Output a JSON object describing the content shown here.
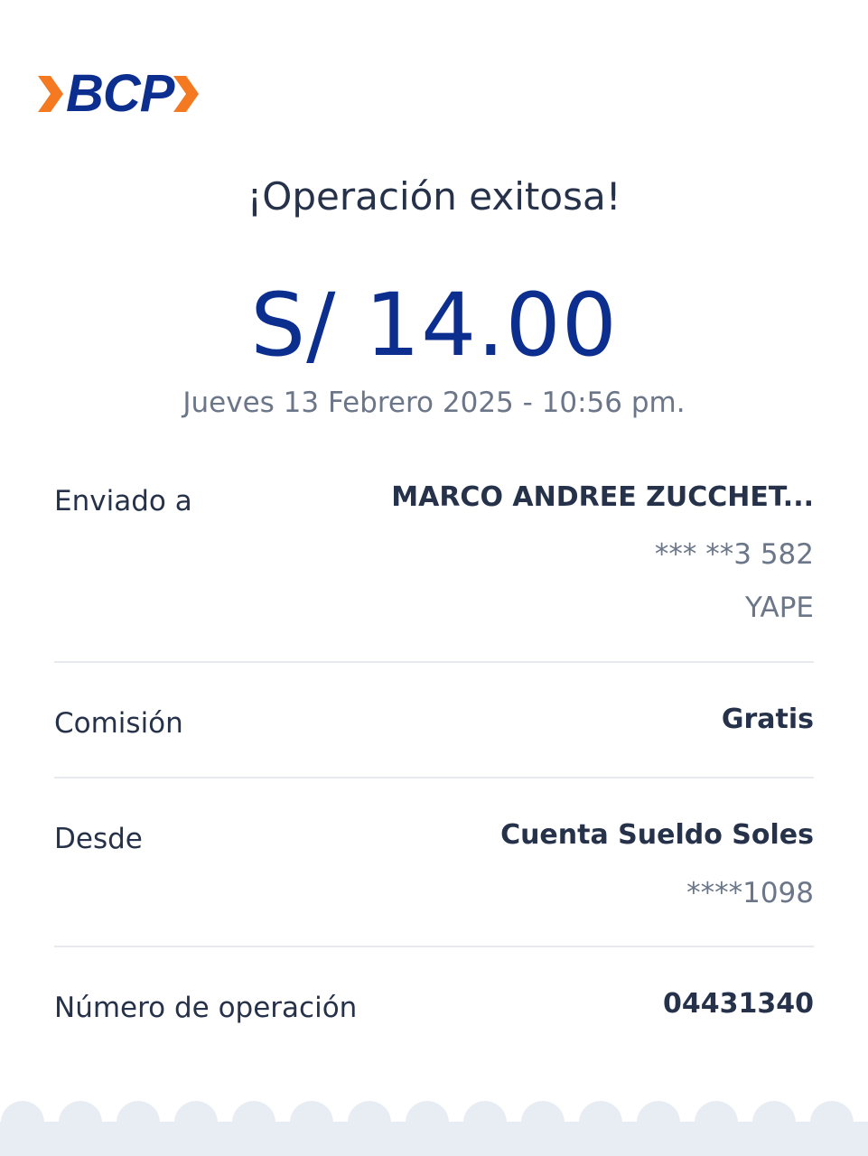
{
  "brand": {
    "name": "BCP",
    "primary_color": "#0c2e8f",
    "accent_color": "#f47920"
  },
  "receipt": {
    "title": "¡Operación exitosa!",
    "amount": "S/ 14.00",
    "datetime": "Jueves 13 Febrero 2025 - 10:56 pm."
  },
  "details": {
    "recipient": {
      "label": "Enviado a",
      "name": "MARCO ANDREE ZUCCHET...",
      "phone": "*** **3 582",
      "channel": "YAPE"
    },
    "commission": {
      "label": "Comisión",
      "value": "Gratis"
    },
    "source": {
      "label": "Desde",
      "account": "Cuenta Sueldo Soles",
      "number": "****1098"
    },
    "operation": {
      "label": "Número de operación",
      "value": "04431340"
    }
  },
  "footer": {
    "background_color": "#e8edf4"
  }
}
